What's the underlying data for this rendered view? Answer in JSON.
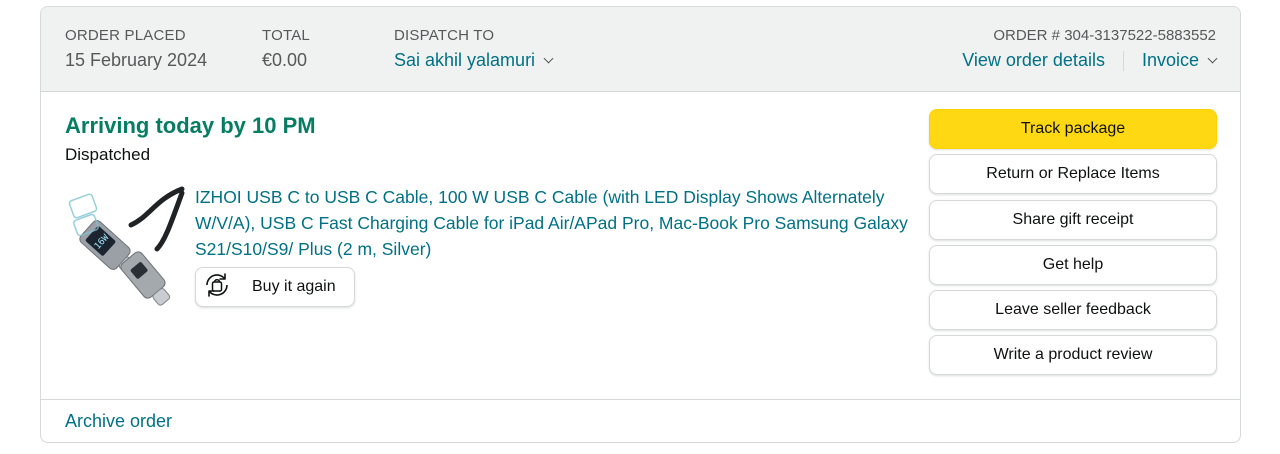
{
  "header": {
    "order_placed_label": "ORDER PLACED",
    "order_placed_value": "15 February 2024",
    "total_label": "TOTAL",
    "total_value": "€0.00",
    "dispatch_label": "DISPATCH TO",
    "dispatch_value": "Sai akhil yalamuri",
    "order_number": "ORDER # 304-3137522-5883552",
    "view_details": "View order details",
    "invoice": "Invoice"
  },
  "shipment": {
    "arrival": "Arriving today by 10 PM",
    "status": "Dispatched"
  },
  "product": {
    "title": "IZHOI USB C to USB C Cable, 100 W USB C Cable (with LED Display Shows Alternately W/V/A), USB C Fast Charging Cable for iPad Air/APad Pro, Mac-Book Pro Samsung Galaxy S21/S10/S9/ Plus (2 m, Silver)",
    "buy_again": "Buy it again",
    "display_text": "16W"
  },
  "actions": [
    "Track package",
    "Return or Replace Items",
    "Share gift receipt",
    "Get help",
    "Leave seller feedback",
    "Write a product review"
  ],
  "footer": {
    "archive": "Archive order"
  },
  "colors": {
    "link": "#007185",
    "arrival": "#067d62",
    "primary_button": "#ffd814",
    "header_bg": "#f0f2f2"
  },
  "icons": {
    "buy_again": "buy-again-icon",
    "chevron": "chevron-down-icon"
  }
}
